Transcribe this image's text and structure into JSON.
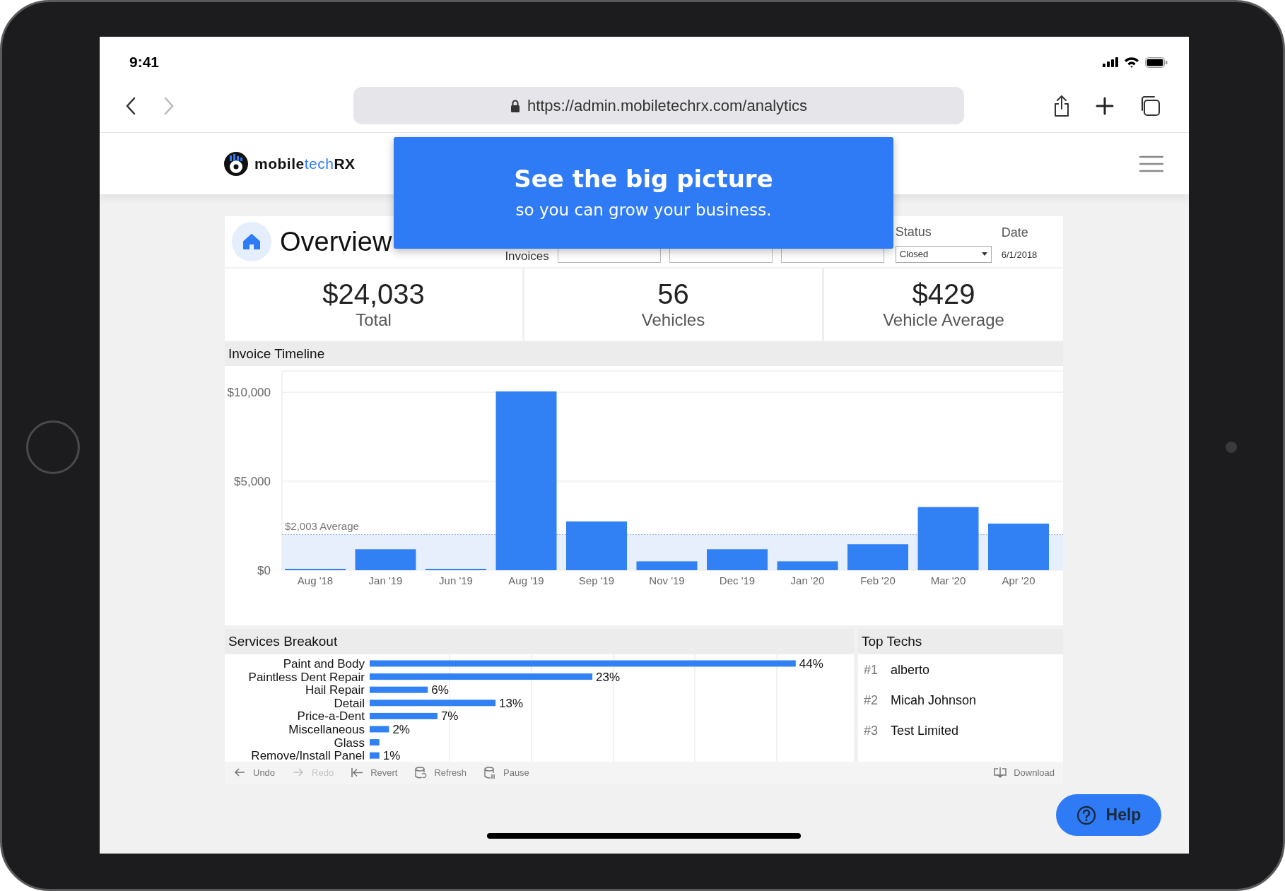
{
  "status_bar": {
    "time": "9:41"
  },
  "browser": {
    "url": "https://admin.mobiletechrx.com/analytics",
    "back_disabled": false,
    "forward_disabled": true
  },
  "site_header": {
    "logo_text": [
      "mobile",
      "tech",
      "RX"
    ]
  },
  "banner": {
    "title": "See the big picture",
    "subtitle": "so you can grow your business."
  },
  "overview": {
    "title": "Overview",
    "invoices_label": "Invoices",
    "status": {
      "label": "Status",
      "value": "Closed"
    },
    "date": {
      "label": "Date",
      "value": "6/1/2018"
    }
  },
  "kpis": [
    {
      "value": "$24,033",
      "label": "Total"
    },
    {
      "value": "56",
      "label": "Vehicles"
    },
    {
      "value": "$429",
      "label": "Vehicle Average"
    }
  ],
  "invoice_timeline": {
    "title": "Invoice Timeline",
    "chart_data": {
      "type": "bar",
      "categories": [
        "Aug '18",
        "Jan '19",
        "Jun '19",
        "Aug '19",
        "Sep '19",
        "Nov '19",
        "Dec '19",
        "Jan '20",
        "Feb '20",
        "Mar '20",
        "Apr '20"
      ],
      "values": [
        60,
        1180,
        40,
        10050,
        2740,
        500,
        1180,
        500,
        1460,
        3550,
        2620
      ],
      "ylim": [
        0,
        11200
      ],
      "yticks": [
        {
          "value": 0,
          "label": "$0"
        },
        {
          "value": 5000,
          "label": "$5,000"
        },
        {
          "value": 10000,
          "label": "$10,000"
        }
      ],
      "ref_lines": [
        {
          "axis": "y",
          "value": 2003,
          "label": "$2,003 Average"
        }
      ],
      "bands": [
        {
          "axis": "y",
          "from": 0,
          "to": 2003
        }
      ]
    }
  },
  "services_breakout": {
    "title": "Services Breakout",
    "chart_data": {
      "type": "bar",
      "orientation": "horizontal",
      "categories": [
        "Paint and Body",
        "Paintless Dent Repair",
        "Hail Repair",
        "Detail",
        "Price-a-Dent",
        "Miscellaneous",
        "Glass",
        "Remove/Install Panel"
      ],
      "values": [
        44,
        23,
        6,
        13,
        7,
        2,
        1,
        1
      ],
      "value_labels": [
        "44%",
        "23%",
        "6%",
        "13%",
        "7%",
        "2%",
        null,
        "1%"
      ]
    }
  },
  "top_techs": {
    "title": "Top Techs",
    "items": [
      {
        "rank": "#1",
        "name": "alberto"
      },
      {
        "rank": "#2",
        "name": "Micah Johnson"
      },
      {
        "rank": "#3",
        "name": "Test Limited"
      }
    ]
  },
  "toolbar": [
    {
      "kind": "undo",
      "label": "Undo",
      "disabled": false
    },
    {
      "kind": "redo",
      "label": "Redo",
      "disabled": true
    },
    {
      "kind": "revert",
      "label": "Revert",
      "disabled": false
    },
    {
      "kind": "refresh",
      "label": "Refresh",
      "disabled": false
    },
    {
      "kind": "pause",
      "label": "Pause",
      "disabled": false
    },
    {
      "kind": "download",
      "label": "Download",
      "disabled": false
    }
  ],
  "help_button": {
    "label": "Help"
  }
}
